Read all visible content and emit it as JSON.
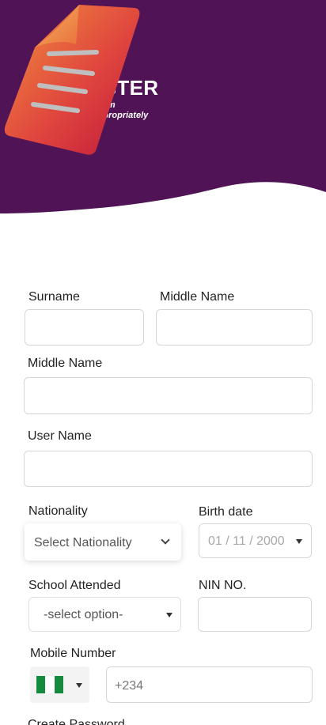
{
  "header": {
    "title": "REGISTER",
    "subtitle_line1": "New User Form",
    "subtitle_line2": "Kindly fill appropriately"
  },
  "colors": {
    "header_bg": "#501456",
    "flag_green": "#138a3d",
    "placeholder": "#9a9a9a"
  },
  "form": {
    "surname": {
      "label": "Surname",
      "value": ""
    },
    "middle_name_top": {
      "label": "Middle Name",
      "value": ""
    },
    "middle_name": {
      "label": "Middle Name",
      "value": ""
    },
    "user_name": {
      "label": "User Name",
      "value": ""
    },
    "nationality": {
      "label": "Nationality",
      "selected": "Select Nationality"
    },
    "birth_date": {
      "label": "Birth date",
      "value": "01 / 11 / 2000"
    },
    "school": {
      "label": "School Attended",
      "selected": "-select option-"
    },
    "nin": {
      "label": "NIN NO.",
      "value": ""
    },
    "mobile": {
      "label": "Mobile Number",
      "country_code": "+234",
      "country_flag": "nigeria-flag-icon"
    },
    "create_password": {
      "label": "Create Password"
    }
  }
}
